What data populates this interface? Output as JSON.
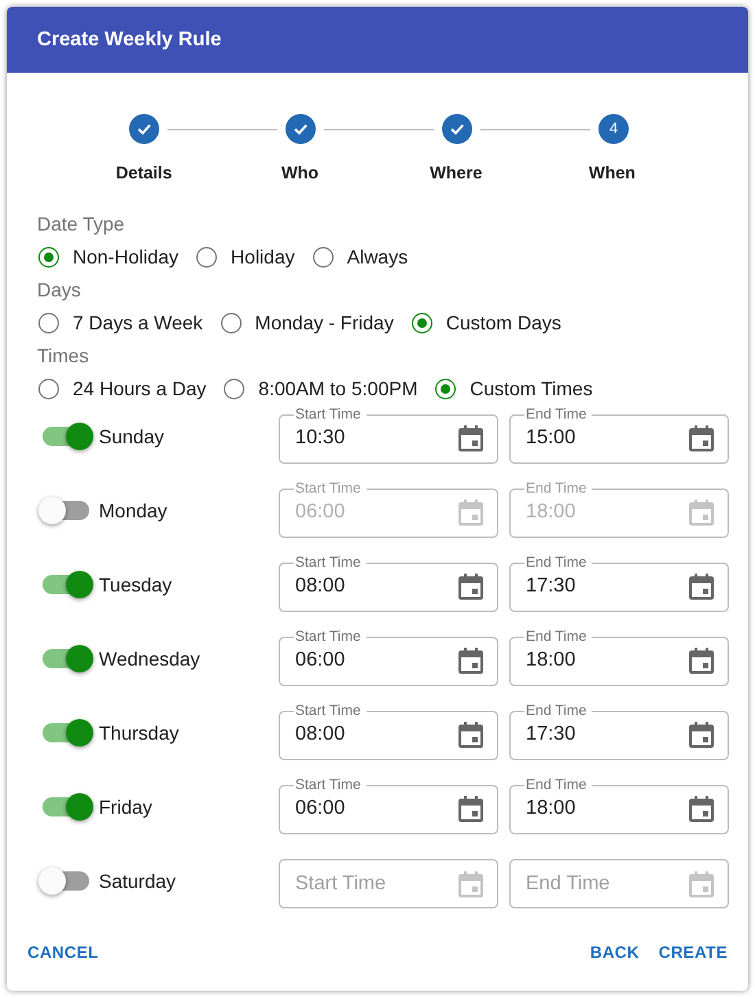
{
  "dialog": {
    "title": "Create Weekly Rule"
  },
  "steps": [
    {
      "label": "Details",
      "done": true
    },
    {
      "label": "Who",
      "done": true
    },
    {
      "label": "Where",
      "done": true
    },
    {
      "label": "When",
      "done": false,
      "number": "4"
    }
  ],
  "groups": [
    {
      "label": "Date Type",
      "options": [
        {
          "label": "Non-Holiday",
          "selected": true
        },
        {
          "label": "Holiday",
          "selected": false
        },
        {
          "label": "Always",
          "selected": false
        }
      ]
    },
    {
      "label": "Days",
      "options": [
        {
          "label": "7 Days a Week",
          "selected": false
        },
        {
          "label": "Monday - Friday",
          "selected": false
        },
        {
          "label": "Custom Days",
          "selected": true
        }
      ]
    },
    {
      "label": "Times",
      "options": [
        {
          "label": "24 Hours a Day",
          "selected": false
        },
        {
          "label": "8:00AM to 5:00PM",
          "selected": false
        },
        {
          "label": "Custom Times",
          "selected": true
        }
      ]
    }
  ],
  "days": [
    {
      "name": "Sunday",
      "on": true,
      "start": {
        "label": "Start Time",
        "value": "10:30"
      },
      "end": {
        "label": "End Time",
        "value": "15:00"
      }
    },
    {
      "name": "Monday",
      "on": false,
      "start": {
        "label": "Start Time",
        "value": "06:00"
      },
      "end": {
        "label": "End Time",
        "value": "18:00"
      }
    },
    {
      "name": "Tuesday",
      "on": true,
      "start": {
        "label": "Start Time",
        "value": "08:00"
      },
      "end": {
        "label": "End Time",
        "value": "17:30"
      }
    },
    {
      "name": "Wednesday",
      "on": true,
      "start": {
        "label": "Start Time",
        "value": "06:00"
      },
      "end": {
        "label": "End Time",
        "value": "18:00"
      }
    },
    {
      "name": "Thursday",
      "on": true,
      "start": {
        "label": "Start Time",
        "value": "08:00"
      },
      "end": {
        "label": "End Time",
        "value": "17:30"
      }
    },
    {
      "name": "Friday",
      "on": true,
      "start": {
        "label": "Start Time",
        "value": "06:00"
      },
      "end": {
        "label": "End Time",
        "value": "18:00"
      }
    },
    {
      "name": "Saturday",
      "on": false,
      "start": {
        "placeholder": "Start Time"
      },
      "end": {
        "placeholder": "End Time"
      }
    }
  ],
  "actions": {
    "left": [
      "CANCEL"
    ],
    "right": [
      "BACK",
      "CREATE"
    ]
  }
}
